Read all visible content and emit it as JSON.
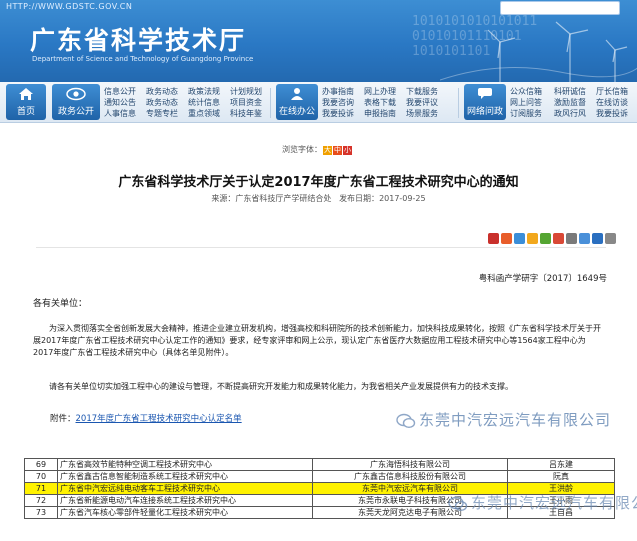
{
  "header": {
    "url": "HTTP://WWW.GDSTC.GOV.CN",
    "title": "广东省科学技术厅",
    "subtitle": "Department of Science and Technology of Guangdong Province",
    "binary_text": "1010101010101011\n01010101110101\n1010101101"
  },
  "nav": {
    "home": "首页",
    "gov_open": "政务公开",
    "col1": [
      "信息公开",
      "通知公告",
      "人事信息"
    ],
    "col2": [
      "政务动态",
      "政务动态",
      "专题专栏"
    ],
    "col3": [
      "政策法规",
      "统计信息",
      "重点领域"
    ],
    "col4": [
      "计划规划",
      "项目资金",
      "科技年鉴"
    ],
    "online": "在线办公",
    "col5": [
      "办事指南",
      "我要咨询",
      "我要投诉"
    ],
    "col6": [
      "网上办理",
      "表格下载",
      "申报指南"
    ],
    "col7": [
      "下载服务",
      "我要评议",
      "场景服务"
    ],
    "interaction": "网络问政",
    "col8": [
      "公众信箱",
      "网上问答",
      "订阅服务"
    ],
    "col9": [
      "科研诚信",
      "激励监督",
      "政风行风"
    ],
    "col10": [
      "厅长信箱",
      "在线访谈",
      "我要投诉"
    ]
  },
  "browse": {
    "label": "浏览字体：",
    "sizes": [
      "大",
      "中",
      "小"
    ],
    "colors": [
      "#f0a000",
      "#e84d1c",
      "#d6332a"
    ]
  },
  "article": {
    "title": "广东省科学技术厅关于认定2017年度广东省工程技术研究中心的通知",
    "source_label": "来源：",
    "source": "广东省科技厅产学研结合处",
    "date_label": "发布日期：",
    "date": "2017-09-25",
    "doc_no": "粤科函产学研字〔2017〕1649号",
    "greeting": "各有关单位：",
    "para1": "为深入贯彻落实全省创新发展大会精神，推进企业建立研发机构，增强高校和科研院所的技术创新能力，加快科技成果转化，按照《广东省科学技术厅关于开展2017年度广东省工程技术研究中心认定工作的通知》要求，经专家评审和网上公示，现认定广东省医疗大数据应用工程技术研究中心等1564家工程中心为2017年度广东省工程技术研究中心（具体名单见附件）。",
    "para2": "请各有关单位切实加强工程中心的建设与管理，不断提高研究开发能力和成果转化能力，为我省相关产业发展提供有力的技术支撑。",
    "attachment_label": "附件：",
    "attachment_link": "2017年度广东省工程技术研究中心认定名单"
  },
  "share_colors": [
    "#c9302c",
    "#e85d2a",
    "#3b8ed8",
    "#f2a81d",
    "#55a532",
    "#d94835",
    "#7a7a7a",
    "#4a90d9",
    "#2a6fc0",
    "#888888"
  ],
  "watermark": "东莞中汽宏远汽车有限公司",
  "table": {
    "rows": [
      {
        "num": "69",
        "name": "广东省高效节能特种空调工程技术研究中心",
        "org": "广东海悟科技有限公司",
        "person": "吕东建",
        "highlight": false
      },
      {
        "num": "70",
        "name": "广东省鑫古信息智能制造系统工程技术研究中心",
        "org": "广东鑫古信息科技股份有限公司",
        "person": "阮真",
        "highlight": false
      },
      {
        "num": "71",
        "name": "广东省中汽宏远纯电动客车工程技术研究中心",
        "org": "东莞中汽宏远汽车有限公司",
        "person": "王洪龄",
        "highlight": true
      },
      {
        "num": "72",
        "name": "广东省新能源电动汽车连接系统工程技术研究中心",
        "org": "东莞市永联电子科技有限公司",
        "person": "王小雨",
        "highlight": false
      },
      {
        "num": "73",
        "name": "广东省汽车核心零部件轻量化工程技术研究中心",
        "org": "东莞天龙阿克达电子有限公司",
        "person": "王自昌",
        "highlight": false
      }
    ]
  }
}
